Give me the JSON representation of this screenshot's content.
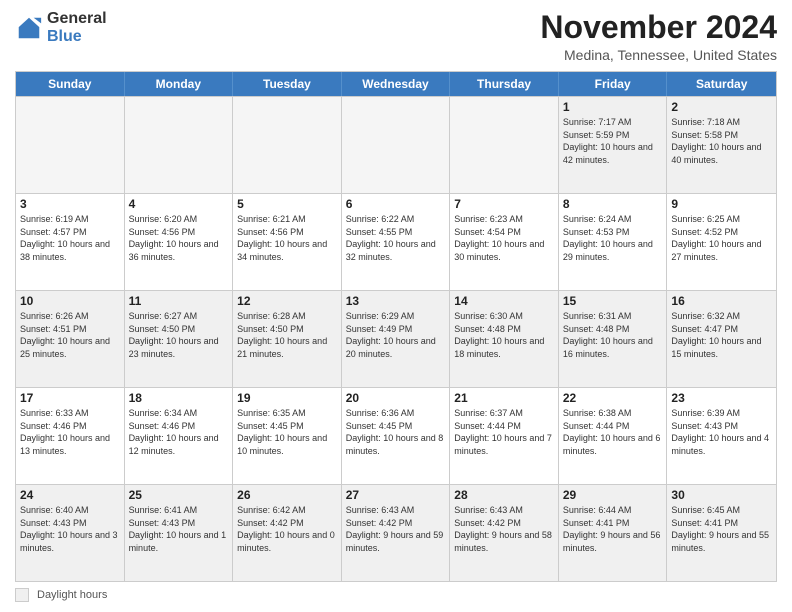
{
  "logo": {
    "general": "General",
    "blue": "Blue"
  },
  "title": "November 2024",
  "location": "Medina, Tennessee, United States",
  "days_of_week": [
    "Sunday",
    "Monday",
    "Tuesday",
    "Wednesday",
    "Thursday",
    "Friday",
    "Saturday"
  ],
  "footer": {
    "daylight_label": "Daylight hours"
  },
  "weeks": [
    [
      {
        "day": "",
        "info": "",
        "empty": true
      },
      {
        "day": "",
        "info": "",
        "empty": true
      },
      {
        "day": "",
        "info": "",
        "empty": true
      },
      {
        "day": "",
        "info": "",
        "empty": true
      },
      {
        "day": "",
        "info": "",
        "empty": true
      },
      {
        "day": "1",
        "info": "Sunrise: 7:17 AM\nSunset: 5:59 PM\nDaylight: 10 hours and 42 minutes."
      },
      {
        "day": "2",
        "info": "Sunrise: 7:18 AM\nSunset: 5:58 PM\nDaylight: 10 hours and 40 minutes."
      }
    ],
    [
      {
        "day": "3",
        "info": "Sunrise: 6:19 AM\nSunset: 4:57 PM\nDaylight: 10 hours and 38 minutes."
      },
      {
        "day": "4",
        "info": "Sunrise: 6:20 AM\nSunset: 4:56 PM\nDaylight: 10 hours and 36 minutes."
      },
      {
        "day": "5",
        "info": "Sunrise: 6:21 AM\nSunset: 4:56 PM\nDaylight: 10 hours and 34 minutes."
      },
      {
        "day": "6",
        "info": "Sunrise: 6:22 AM\nSunset: 4:55 PM\nDaylight: 10 hours and 32 minutes."
      },
      {
        "day": "7",
        "info": "Sunrise: 6:23 AM\nSunset: 4:54 PM\nDaylight: 10 hours and 30 minutes."
      },
      {
        "day": "8",
        "info": "Sunrise: 6:24 AM\nSunset: 4:53 PM\nDaylight: 10 hours and 29 minutes."
      },
      {
        "day": "9",
        "info": "Sunrise: 6:25 AM\nSunset: 4:52 PM\nDaylight: 10 hours and 27 minutes."
      }
    ],
    [
      {
        "day": "10",
        "info": "Sunrise: 6:26 AM\nSunset: 4:51 PM\nDaylight: 10 hours and 25 minutes."
      },
      {
        "day": "11",
        "info": "Sunrise: 6:27 AM\nSunset: 4:50 PM\nDaylight: 10 hours and 23 minutes."
      },
      {
        "day": "12",
        "info": "Sunrise: 6:28 AM\nSunset: 4:50 PM\nDaylight: 10 hours and 21 minutes."
      },
      {
        "day": "13",
        "info": "Sunrise: 6:29 AM\nSunset: 4:49 PM\nDaylight: 10 hours and 20 minutes."
      },
      {
        "day": "14",
        "info": "Sunrise: 6:30 AM\nSunset: 4:48 PM\nDaylight: 10 hours and 18 minutes."
      },
      {
        "day": "15",
        "info": "Sunrise: 6:31 AM\nSunset: 4:48 PM\nDaylight: 10 hours and 16 minutes."
      },
      {
        "day": "16",
        "info": "Sunrise: 6:32 AM\nSunset: 4:47 PM\nDaylight: 10 hours and 15 minutes."
      }
    ],
    [
      {
        "day": "17",
        "info": "Sunrise: 6:33 AM\nSunset: 4:46 PM\nDaylight: 10 hours and 13 minutes."
      },
      {
        "day": "18",
        "info": "Sunrise: 6:34 AM\nSunset: 4:46 PM\nDaylight: 10 hours and 12 minutes."
      },
      {
        "day": "19",
        "info": "Sunrise: 6:35 AM\nSunset: 4:45 PM\nDaylight: 10 hours and 10 minutes."
      },
      {
        "day": "20",
        "info": "Sunrise: 6:36 AM\nSunset: 4:45 PM\nDaylight: 10 hours and 8 minutes."
      },
      {
        "day": "21",
        "info": "Sunrise: 6:37 AM\nSunset: 4:44 PM\nDaylight: 10 hours and 7 minutes."
      },
      {
        "day": "22",
        "info": "Sunrise: 6:38 AM\nSunset: 4:44 PM\nDaylight: 10 hours and 6 minutes."
      },
      {
        "day": "23",
        "info": "Sunrise: 6:39 AM\nSunset: 4:43 PM\nDaylight: 10 hours and 4 minutes."
      }
    ],
    [
      {
        "day": "24",
        "info": "Sunrise: 6:40 AM\nSunset: 4:43 PM\nDaylight: 10 hours and 3 minutes."
      },
      {
        "day": "25",
        "info": "Sunrise: 6:41 AM\nSunset: 4:43 PM\nDaylight: 10 hours and 1 minute."
      },
      {
        "day": "26",
        "info": "Sunrise: 6:42 AM\nSunset: 4:42 PM\nDaylight: 10 hours and 0 minutes."
      },
      {
        "day": "27",
        "info": "Sunrise: 6:43 AM\nSunset: 4:42 PM\nDaylight: 9 hours and 59 minutes."
      },
      {
        "day": "28",
        "info": "Sunrise: 6:43 AM\nSunset: 4:42 PM\nDaylight: 9 hours and 58 minutes."
      },
      {
        "day": "29",
        "info": "Sunrise: 6:44 AM\nSunset: 4:41 PM\nDaylight: 9 hours and 56 minutes."
      },
      {
        "day": "30",
        "info": "Sunrise: 6:45 AM\nSunset: 4:41 PM\nDaylight: 9 hours and 55 minutes."
      }
    ]
  ]
}
